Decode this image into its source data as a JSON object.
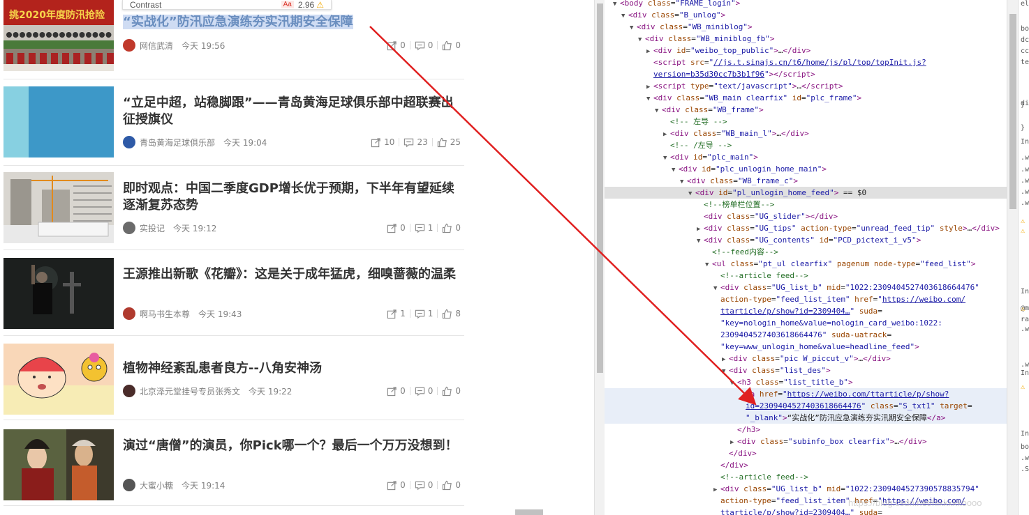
{
  "tooltip": {
    "label": "Contrast",
    "badge": "Aa",
    "ratio": "2.96"
  },
  "feed": [
    {
      "title": "“实战化”防汛应急演练夯实汛期安全保障",
      "author": "网信武清",
      "time": "今天 19:56",
      "shares": "0",
      "comments": "0",
      "likes": "0",
      "thumb": "banner",
      "avatar_color": "#c0392b"
    },
    {
      "title": "“立足中超，站稳脚跟”——青岛黄海足球俱乐部中超联赛出征授旗仪",
      "author": "青岛黄海足球俱乐部",
      "time": "今天 19:04",
      "shares": "10",
      "comments": "23",
      "likes": "25",
      "thumb": "blue",
      "avatar_color": "#2e5aa7"
    },
    {
      "title": "即时观点：中国二季度GDP增长优于预期，下半年有望延续逐渐复苏态势",
      "author": "实投记",
      "time": "今天 19:12",
      "shares": "0",
      "comments": "1",
      "likes": "0",
      "thumb": "construction",
      "avatar_color": "#6b6b6b"
    },
    {
      "title": "王源推出新歌《花瓣》：这是关于成年猛虎，细嗅蔷薇的温柔",
      "author": "啊马书生本尊",
      "time": "今天 19:43",
      "shares": "1",
      "comments": "1",
      "likes": "8",
      "thumb": "dark",
      "avatar_color": "#b03a2e"
    },
    {
      "title": "植物神经紊乱患者良方--八角安神汤",
      "author": "北京泽元堂挂号专员张秀文",
      "time": "今天 19:22",
      "shares": "0",
      "comments": "0",
      "likes": "0",
      "thumb": "cartoon",
      "avatar_color": "#4a2c2a"
    },
    {
      "title": "演过“唐僧”的演员，你Pick哪一个？最后一个万万没想到！",
      "author": "大蜜小糖",
      "time": "今天 19:14",
      "shares": "0",
      "comments": "0",
      "likes": "0",
      "thumb": "costume",
      "avatar_color": "#555"
    }
  ],
  "devtools": {
    "more_dots": "•••",
    "lines": [
      {
        "indent": 1,
        "tri": "▼",
        "html": "<span class='tag'>&lt;body</span> <span class='attr'>class</span>=<span class='val'>\"FRAME_login\"</span><span class='tag'>&gt;</span>"
      },
      {
        "indent": 2,
        "tri": "▼",
        "html": "<span class='tag'>&lt;div</span> <span class='attr'>class</span>=<span class='val'>\"B_unlog\"</span><span class='tag'>&gt;</span>"
      },
      {
        "indent": 3,
        "tri": "▼",
        "html": "<span class='tag'>&lt;div</span> <span class='attr'>class</span>=<span class='val'>\"WB_miniblog\"</span><span class='tag'>&gt;</span>"
      },
      {
        "indent": 4,
        "tri": "▼",
        "html": "<span class='tag'>&lt;div</span> <span class='attr'>class</span>=<span class='val'>\"WB_miniblog_fb\"</span><span class='tag'>&gt;</span>"
      },
      {
        "indent": 5,
        "tri": "▶",
        "html": "<span class='tag'>&lt;div</span> <span class='attr'>id</span>=<span class='val'>\"weibo_top_public\"</span><span class='tag'>&gt;</span>…<span class='tag'>&lt;/div&gt;</span>"
      },
      {
        "indent": 5,
        "tri": "",
        "html": "<span class='tag'>&lt;script</span> <span class='attr'>src</span>=<span class='val'>\"</span><span class='link'>//js.t.sinajs.cn/t6/home/js/pl/top/topInit.js?</span>"
      },
      {
        "indent": 5,
        "tri": "",
        "html": "<span class='link'>version=b35d30cc7b3b1f96</span><span class='val'>\"</span><span class='tag'>&gt;&lt;/script&gt;</span>"
      },
      {
        "indent": 5,
        "tri": "▶",
        "html": "<span class='tag'>&lt;script</span> <span class='attr'>type</span>=<span class='val'>\"text/javascript\"</span><span class='tag'>&gt;</span>…<span class='tag'>&lt;/script&gt;</span>"
      },
      {
        "indent": 5,
        "tri": "▼",
        "html": "<span class='tag'>&lt;div</span> <span class='attr'>class</span>=<span class='val'>\"WB_main clearfix\"</span> <span class='attr'>id</span>=<span class='val'>\"plc_frame\"</span><span class='tag'>&gt;</span>"
      },
      {
        "indent": 6,
        "tri": "▼",
        "html": "<span class='tag'>&lt;div</span> <span class='attr'>class</span>=<span class='val'>\"WB_frame\"</span><span class='tag'>&gt;</span>"
      },
      {
        "indent": 7,
        "tri": "",
        "html": "<span class='comment'>&lt;!-- 左导 --&gt;</span>"
      },
      {
        "indent": 7,
        "tri": "▶",
        "html": "<span class='tag'>&lt;div</span> <span class='attr'>class</span>=<span class='val'>\"WB_main_l\"</span><span class='tag'>&gt;</span>…<span class='tag'>&lt;/div&gt;</span>"
      },
      {
        "indent": 7,
        "tri": "",
        "html": "<span class='comment'>&lt;!-- /左导 --&gt;</span>"
      },
      {
        "indent": 7,
        "tri": "▼",
        "html": "<span class='tag'>&lt;div</span> <span class='attr'>id</span>=<span class='val'>\"plc_main\"</span><span class='tag'>&gt;</span>"
      },
      {
        "indent": 8,
        "tri": "▼",
        "html": "<span class='tag'>&lt;div</span> <span class='attr'>id</span>=<span class='val'>\"plc_unlogin_home_main\"</span><span class='tag'>&gt;</span>"
      },
      {
        "indent": 9,
        "tri": "▼",
        "html": "<span class='tag'>&lt;div</span> <span class='attr'>class</span>=<span class='val'>\"WB_frame_c\"</span><span class='tag'>&gt;</span>"
      },
      {
        "indent": 10,
        "tri": "▼",
        "sel": true,
        "html": "<span class='tag'>&lt;div</span> <span class='attr'>id</span>=<span class='val'>\"pl_unlogin_home_feed\"</span><span class='tag'>&gt;</span> == $0"
      },
      {
        "indent": 11,
        "tri": "",
        "html": "<span class='comment'>&lt;!--榜单栏位置--&gt;</span>"
      },
      {
        "indent": 11,
        "tri": "",
        "html": "<span class='tag'>&lt;div</span> <span class='attr'>class</span>=<span class='val'>\"UG_slider\"</span><span class='tag'>&gt;&lt;/div&gt;</span>"
      },
      {
        "indent": 11,
        "tri": "▶",
        "html": "<span class='tag'>&lt;div</span> <span class='attr'>class</span>=<span class='val'>\"UG_tips\"</span> <span class='attr'>action-type</span>=<span class='val'>\"unread_feed_tip\"</span> <span class='attr'>style</span><span class='tag'>&gt;</span>…<span class='tag'>&lt;/div&gt;</span>"
      },
      {
        "indent": 11,
        "tri": "▼",
        "html": "<span class='tag'>&lt;div</span> <span class='attr'>class</span>=<span class='val'>\"UG_contents\"</span> <span class='attr'>id</span>=<span class='val'>\"PCD_pictext_i_v5\"</span><span class='tag'>&gt;</span>"
      },
      {
        "indent": 12,
        "tri": "",
        "html": "<span class='comment'>&lt;!--feed内容--&gt;</span>"
      },
      {
        "indent": 12,
        "tri": "▼",
        "html": "<span class='tag'>&lt;ul</span> <span class='attr'>class</span>=<span class='val'>\"pt_ul clearfix\"</span> <span class='attr'>pagenum</span> <span class='attr'>node-type</span>=<span class='val'>\"feed_list\"</span><span class='tag'>&gt;</span>"
      },
      {
        "indent": 13,
        "tri": "",
        "html": "<span class='comment'>&lt;!--article feed--&gt;</span>"
      },
      {
        "indent": 13,
        "tri": "▼",
        "html": "<span class='tag'>&lt;div</span> <span class='attr'>class</span>=<span class='val'>\"UG_list_b\"</span> <span class='attr'>mid</span>=<span class='val'>\"1022:2309404527403618664476\"</span>"
      },
      {
        "indent": 13,
        "tri": "",
        "html": "<span class='attr'>action-type</span>=<span class='val'>\"feed_list_item\"</span> <span class='attr'>href</span>=<span class='val'>\"</span><span class='link'>https://weibo.com/</span>"
      },
      {
        "indent": 13,
        "tri": "",
        "html": "<span class='link'>ttarticle/p/show?id=2309404…</span><span class='val'>\"</span> <span class='attr'>suda</span>="
      },
      {
        "indent": 13,
        "tri": "",
        "html": "<span class='val'>\"key=nologin_home&amp;value=nologin_card_weibo:1022:</span>"
      },
      {
        "indent": 13,
        "tri": "",
        "html": "<span class='val'>2309404527403618664476\"</span> <span class='attr'>suda-uatrack</span>="
      },
      {
        "indent": 13,
        "tri": "",
        "html": "<span class='val'>\"key=www_unlogin_home&amp;value=headline_feed\"</span><span class='tag'>&gt;</span>"
      },
      {
        "indent": 14,
        "tri": "▶",
        "html": "<span class='tag'>&lt;div</span> <span class='attr'>class</span>=<span class='val'>\"pic W_piccut_v\"</span><span class='tag'>&gt;</span>…<span class='tag'>&lt;/div&gt;</span>"
      },
      {
        "indent": 14,
        "tri": "▼",
        "html": "<span class='tag'>&lt;div</span> <span class='attr'>class</span>=<span class='val'>\"list_des\"</span><span class='tag'>&gt;</span>"
      },
      {
        "indent": 15,
        "tri": "▼",
        "html": "<span class='tag'>&lt;h3</span> <span class='attr'>class</span>=<span class='val'>\"list_title_b\"</span><span class='tag'>&gt;</span>"
      },
      {
        "indent": 16,
        "tri": "",
        "hl": true,
        "html": "<span class='tag'>&lt;a</span> <span class='attr'>href</span>=<span class='val'>\"</span><span class='link'>https://weibo.com/ttarticle/p/show?</span>"
      },
      {
        "indent": 16,
        "tri": "",
        "hl": true,
        "html": "<span class='link'>id=2309404527403618664476</span><span class='val'>\"</span> <span class='attr'>class</span>=<span class='val'>\"S_txt1\"</span> <span class='attr'>target</span>="
      },
      {
        "indent": 16,
        "tri": "",
        "hl": true,
        "html": "<span class='val'>\"_blank\"</span><span class='tag'>&gt;</span><span class='txt'>“实战化”防汛应急演练夯实汛期安全保障</span><span class='tag'>&lt;/a&gt;</span>"
      },
      {
        "indent": 15,
        "tri": "",
        "html": "<span class='tag'>&lt;/h3&gt;</span>"
      },
      {
        "indent": 15,
        "tri": "▶",
        "html": "<span class='tag'>&lt;div</span> <span class='attr'>class</span>=<span class='val'>\"subinfo_box clearfix\"</span><span class='tag'>&gt;</span>…<span class='tag'>&lt;/div&gt;</span>"
      },
      {
        "indent": 14,
        "tri": "",
        "html": "<span class='tag'>&lt;/div&gt;</span>"
      },
      {
        "indent": 13,
        "tri": "",
        "html": "<span class='tag'>&lt;/div&gt;</span>"
      },
      {
        "indent": 13,
        "tri": "",
        "html": "<span class='comment'>&lt;!--article feed--&gt;</span>"
      },
      {
        "indent": 13,
        "tri": "▶",
        "html": "<span class='tag'>&lt;div</span> <span class='attr'>class</span>=<span class='val'>\"UG_list_b\"</span> <span class='attr'>mid</span>=<span class='val'>\"1022:2309404527390578835794\"</span>"
      },
      {
        "indent": 13,
        "tri": "",
        "html": "<span class='attr'>action-type</span>=<span class='val'>\"feed_list_item\"</span> <span class='attr'>href</span>=<span class='val'>\"</span><span class='link'>https://weibo.com/</span>"
      },
      {
        "indent": 13,
        "tri": "",
        "html": "<span class='link'>ttarticle/p/show?id=2309404…</span><span class='val'>\"</span> <span class='attr'>suda</span>="
      }
    ]
  },
  "styles_panel": [
    "el",
    "bo",
    "dc",
    "cc",
    "te",
    "}",
    "di",
    "}",
    "In",
    ".w",
    ".w",
    ".w",
    ".w",
    ".w",
    "In",
    "@m",
    "ra",
    ".w",
    "In",
    ".w",
    "In",
    "bo",
    ".w",
    ".S"
  ],
  "watermark": "https://blog.csdn.net/hikkkkkoooo"
}
